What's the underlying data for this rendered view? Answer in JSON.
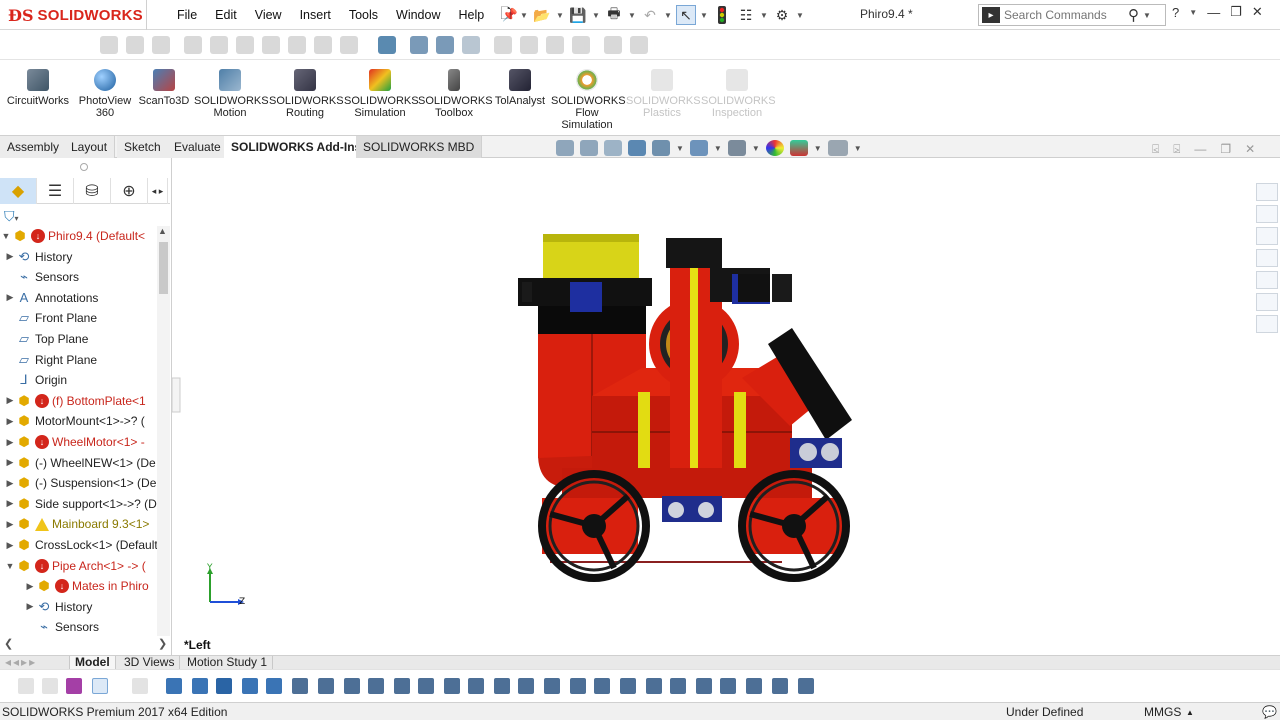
{
  "app": {
    "brand": "SOLIDWORKS",
    "document_title": "Phiro9.4 *"
  },
  "menu": [
    "File",
    "Edit",
    "View",
    "Insert",
    "Tools",
    "Window",
    "Help"
  ],
  "search": {
    "placeholder": "Search Commands"
  },
  "command_manager": [
    {
      "label": "CircuitWorks",
      "icon": "circuitworks-icon",
      "enabled": true
    },
    {
      "label": "PhotoView 360",
      "icon": "photoview-icon",
      "enabled": true
    },
    {
      "label": "ScanTo3D",
      "icon": "scanto3d-icon",
      "enabled": true
    },
    {
      "label": "SOLIDWORKS Motion",
      "icon": "motion-icon",
      "enabled": true
    },
    {
      "label": "SOLIDWORKS Routing",
      "icon": "routing-icon",
      "enabled": true
    },
    {
      "label": "SOLIDWORKS Simulation",
      "icon": "simulation-icon",
      "enabled": true
    },
    {
      "label": "SOLIDWORKS Toolbox",
      "icon": "toolbox-icon",
      "enabled": true
    },
    {
      "label": "TolAnalyst",
      "icon": "tolanalyst-icon",
      "enabled": true
    },
    {
      "label": "SOLIDWORKS Flow Simulation",
      "icon": "flow-simulation-icon",
      "enabled": true
    },
    {
      "label": "SOLIDWORKS Plastics",
      "icon": "plastics-icon",
      "enabled": false
    },
    {
      "label": "SOLIDWORKS Inspection",
      "icon": "inspection-icon",
      "enabled": false
    }
  ],
  "tabs": [
    "Assembly",
    "Layout",
    "Sketch",
    "Evaluate",
    "SOLIDWORKS Add-Ins",
    "SOLIDWORKS MBD"
  ],
  "active_tab": "SOLIDWORKS Add-Ins",
  "feature_tree": [
    {
      "label": "Phiro9.4  (Default<",
      "state": "error",
      "expand": "collapse",
      "indent": 0
    },
    {
      "label": "History",
      "state": "normal",
      "expand": "expand",
      "indent": 1
    },
    {
      "label": "Sensors",
      "state": "normal",
      "expand": "",
      "indent": 1
    },
    {
      "label": "Annotations",
      "state": "normal",
      "expand": "expand",
      "indent": 1
    },
    {
      "label": "Front Plane",
      "state": "normal",
      "expand": "",
      "indent": 1
    },
    {
      "label": "Top Plane",
      "state": "normal",
      "expand": "",
      "indent": 1
    },
    {
      "label": "Right Plane",
      "state": "normal",
      "expand": "",
      "indent": 1
    },
    {
      "label": "Origin",
      "state": "normal",
      "expand": "",
      "indent": 1
    },
    {
      "label": "(f) BottomPlate<1",
      "state": "error",
      "expand": "expand",
      "indent": 1
    },
    {
      "label": "MotorMount<1>->? (",
      "state": "normal",
      "expand": "expand",
      "indent": 1
    },
    {
      "label": "WheelMotor<1> -",
      "state": "error",
      "expand": "expand",
      "indent": 1
    },
    {
      "label": "(-) WheelNEW<1> (De",
      "state": "normal",
      "expand": "expand",
      "indent": 1
    },
    {
      "label": "(-) Suspension<1> (De",
      "state": "normal",
      "expand": "expand",
      "indent": 1
    },
    {
      "label": "Side support<1>->? (D",
      "state": "normal",
      "expand": "expand",
      "indent": 1
    },
    {
      "label": "Mainboard 9.3<1>",
      "state": "warning",
      "expand": "expand",
      "indent": 1
    },
    {
      "label": "CrossLock<1>  (Default",
      "state": "normal",
      "expand": "expand",
      "indent": 1
    },
    {
      "label": "Pipe Arch<1> -> (",
      "state": "error",
      "expand": "collapse",
      "indent": 1
    },
    {
      "label": "Mates in Phiro",
      "state": "error",
      "expand": "expand",
      "indent": 2
    },
    {
      "label": "History",
      "state": "normal",
      "expand": "expand",
      "indent": 2
    },
    {
      "label": "Sensors",
      "state": "normal",
      "expand": "",
      "indent": 2
    }
  ],
  "viewport": {
    "view_orientation": "*Left",
    "axis_y": "Y",
    "axis_z": "Z"
  },
  "bottom_tabs": [
    "Model",
    "3D Views",
    "Motion Study 1"
  ],
  "status": {
    "edition": "SOLIDWORKS Premium 2017 x64 Edition",
    "state": "Under Defined",
    "units": "MMGS"
  },
  "colors": {
    "accent_red": "#d9261c",
    "model_red": "#e0220e",
    "model_yellow": "#e8e200",
    "model_black": "#111111"
  }
}
